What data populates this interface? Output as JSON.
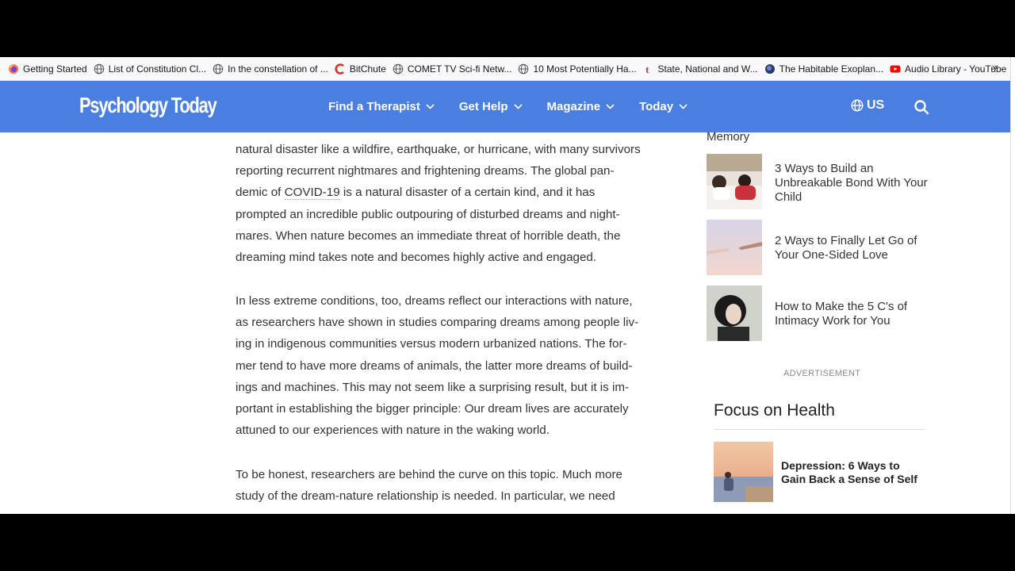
{
  "bookmarks": {
    "items": [
      {
        "label": "Getting Started",
        "icon": "firefox-icon"
      },
      {
        "label": "List of Constitution Cl...",
        "icon": "globe-icon"
      },
      {
        "label": "In the constellation of ...",
        "icon": "globe-icon"
      },
      {
        "label": "BitChute",
        "icon": "bitchute-icon"
      },
      {
        "label": "COMET TV Sci-fi Netw...",
        "icon": "globe-icon"
      },
      {
        "label": "10 Most Potentially Ha...",
        "icon": "globe-icon"
      },
      {
        "label": "State, National and W...",
        "icon": "tumblr-icon"
      },
      {
        "label": "The Habitable Exoplan...",
        "icon": "planet-icon"
      },
      {
        "label": "Audio Library - YouTube",
        "icon": "youtube-icon"
      }
    ],
    "overflow_glyph": "»"
  },
  "header": {
    "logo": "Psychology Today",
    "nav": [
      "Find a Therapist",
      "Get Help",
      "Magazine",
      "Today"
    ],
    "region": "US",
    "colors": {
      "brand": "#4a7ee0"
    }
  },
  "article": {
    "para1": [
      "natural disaster like a wildfire, earthquake, or hurricane, with many survivors",
      "reporting recurrent nightmares and frightening dreams. The global pan-",
      "demic of ",
      "COVID-19",
      " is a natural disaster of a certain kind, and it has",
      "prompted an incredible public outpouring of disturbed dreams and night-",
      "mares. When nature becomes an immediate threat of horrible death, the",
      "dreaming mind takes note and becomes highly active and engaged."
    ],
    "para2": [
      "In less extreme conditions, too, dreams reflect our interactions with nature,",
      "as researchers have shown in studies comparing dreams among people liv-",
      "ing in indigenous communities versus modern urbanized nations. The for-",
      "mer tend to have more dreams of animals, the latter more dreams of build-",
      "ings and machines. This may not seem like a surprising result, but it is im-",
      "portant in establishing the bigger principle: Our dream lives are accurately",
      "attuned to our experiences with nature in the waking world."
    ],
    "para3": [
      "To be honest, researchers are behind the curve on this topic. Much more",
      "study of the dream-nature relationship is needed. In particular, we need"
    ]
  },
  "sidebar": {
    "prev_fragment": "Memory",
    "related": [
      "3 Ways to Build an Unbreakable Bond With Your Child",
      "2 Ways to Finally Let Go of Your One-Sided Love",
      "How to Make the 5 C's of Intimacy Work for You"
    ],
    "ad_label": "ADVERTISEMENT",
    "focus_title": "Focus on Health",
    "focus_item": "Depression: 6 Ways to Gain Back a Sense of Self"
  }
}
